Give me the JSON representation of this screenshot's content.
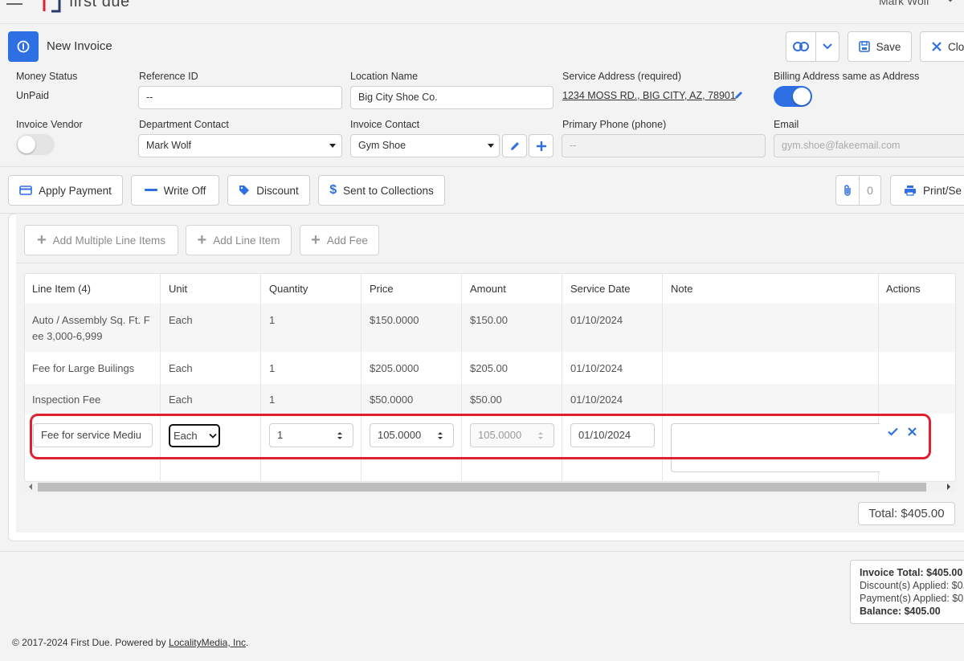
{
  "app": {
    "logo_text": "first due",
    "user_name": "Mark Wolf"
  },
  "header": {
    "title": "New Invoice",
    "save_label": "Save",
    "close_label": "Clo"
  },
  "form": {
    "money_status": {
      "label": "Money Status",
      "value": "UnPaid"
    },
    "reference_id": {
      "label": "Reference ID",
      "value": "--"
    },
    "location_name": {
      "label": "Location Name",
      "value": "Big City Shoe Co."
    },
    "service_address": {
      "label": "Service Address (required)",
      "value": "1234 MOSS RD., BIG CITY, AZ, 78901"
    },
    "billing_same": {
      "label": "Billing Address same as Address",
      "checked": true
    },
    "invoice_vendor": {
      "label": "Invoice Vendor",
      "checked": false
    },
    "department_contact": {
      "label": "Department Contact",
      "value": "Mark Wolf"
    },
    "invoice_contact": {
      "label": "Invoice Contact",
      "value": "Gym Shoe"
    },
    "primary_phone": {
      "label": "Primary Phone (phone)",
      "value": "--"
    },
    "email": {
      "label": "Email",
      "value": "gym.shoe@fakeemail.com"
    }
  },
  "actions": {
    "apply_payment": "Apply Payment",
    "write_off": "Write Off",
    "discount": "Discount",
    "sent_to_collections": "Sent to Collections",
    "attachments_count": "0",
    "print": "Print/Se"
  },
  "line_actions": {
    "add_multiple": "Add Multiple Line Items",
    "add_line": "Add Line Item",
    "add_fee": "Add Fee"
  },
  "table": {
    "headers": [
      "Line Item (4)",
      "Unit",
      "Quantity",
      "Price",
      "Amount",
      "Service Date",
      "Note",
      "Actions"
    ],
    "rows": [
      {
        "item_line1": "Auto / Assembly Sq. Ft. F",
        "item_line2": "ee 3,000-6,999",
        "unit": "Each",
        "quantity": "1",
        "price": "$150.0000",
        "amount": "$150.00",
        "date": "01/10/2024"
      },
      {
        "item_line1": "Fee for Large Builings",
        "item_line2": "",
        "unit": "Each",
        "quantity": "1",
        "price": "$205.0000",
        "amount": "$205.00",
        "date": "01/10/2024"
      },
      {
        "item_line1": "Inspection Fee",
        "item_line2": "",
        "unit": "Each",
        "quantity": "1",
        "price": "$50.0000",
        "amount": "$50.00",
        "date": "01/10/2024"
      }
    ],
    "edit_row": {
      "item": "Fee for service Mediu",
      "unit": "Each",
      "quantity": "1",
      "price": "105.0000",
      "amount": "105.0000",
      "date": "01/10/2024",
      "note": ""
    },
    "total": "Total: $405.00"
  },
  "summary": {
    "invoice_total": "Invoice Total: $405.00",
    "discounts": "Discount(s) Applied: $0.",
    "payments": "Payment(s) Applied: $0.",
    "balance": "Balance: $405.00"
  },
  "footer": {
    "copyright": "© 2017-2024 First Due. Powered by ",
    "link": "LocalityMedia, Inc",
    "suffix": "."
  },
  "colors": {
    "accent": "#2f6fe4",
    "highlight": "#e0202f",
    "toggle_on": "#2f6fe4",
    "toggle_off": "#e4e4e4"
  }
}
